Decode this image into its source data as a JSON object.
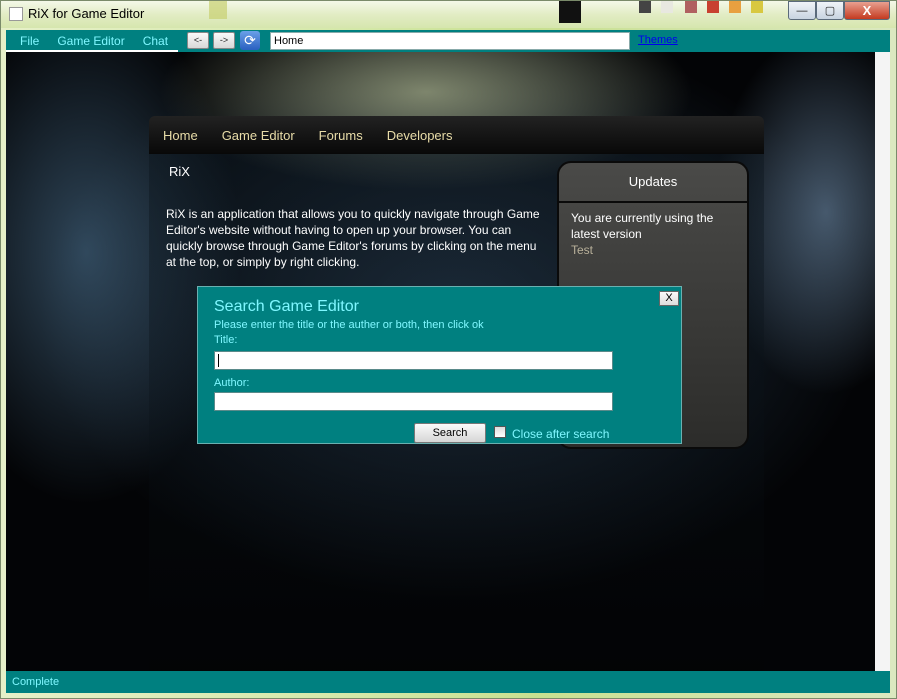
{
  "window": {
    "title": "RiX for Game Editor",
    "minimize_symbol": "—",
    "maximize_symbol": "▢",
    "close_symbol": "X"
  },
  "toolbar": {
    "menu": [
      "File",
      "Game Editor",
      "Chat"
    ],
    "back_label": "<-",
    "forward_label": "->",
    "refresh_symbol": "⟳",
    "address": "Home",
    "themes_link": "Themes"
  },
  "site": {
    "nav": [
      "Home",
      "Game Editor",
      "Forums",
      "Developers"
    ],
    "heading": "RiX",
    "intro": "RiX is an application that allows you to quickly navigate through Game Editor's website without having to open up your browser. You can quickly browse through Game Editor's forums by clicking on the menu at the top, or simply by right clicking.",
    "updates": {
      "title": "Updates",
      "text": "You are currently using the latest version",
      "sub": "Test"
    }
  },
  "dialog": {
    "title": "Search Game Editor",
    "description": "Please enter the title or the auther or both, then click ok",
    "title_label": "Title:",
    "title_value": "",
    "author_label": "Author:",
    "author_value": "",
    "search_button": "Search",
    "close_after_label": "Close after search",
    "close_button": "X"
  },
  "status": {
    "text": "Complete"
  },
  "colors": {
    "teal": "#008080",
    "cyan_text": "#7ff7ff",
    "nav_text": "#e8dca8"
  }
}
